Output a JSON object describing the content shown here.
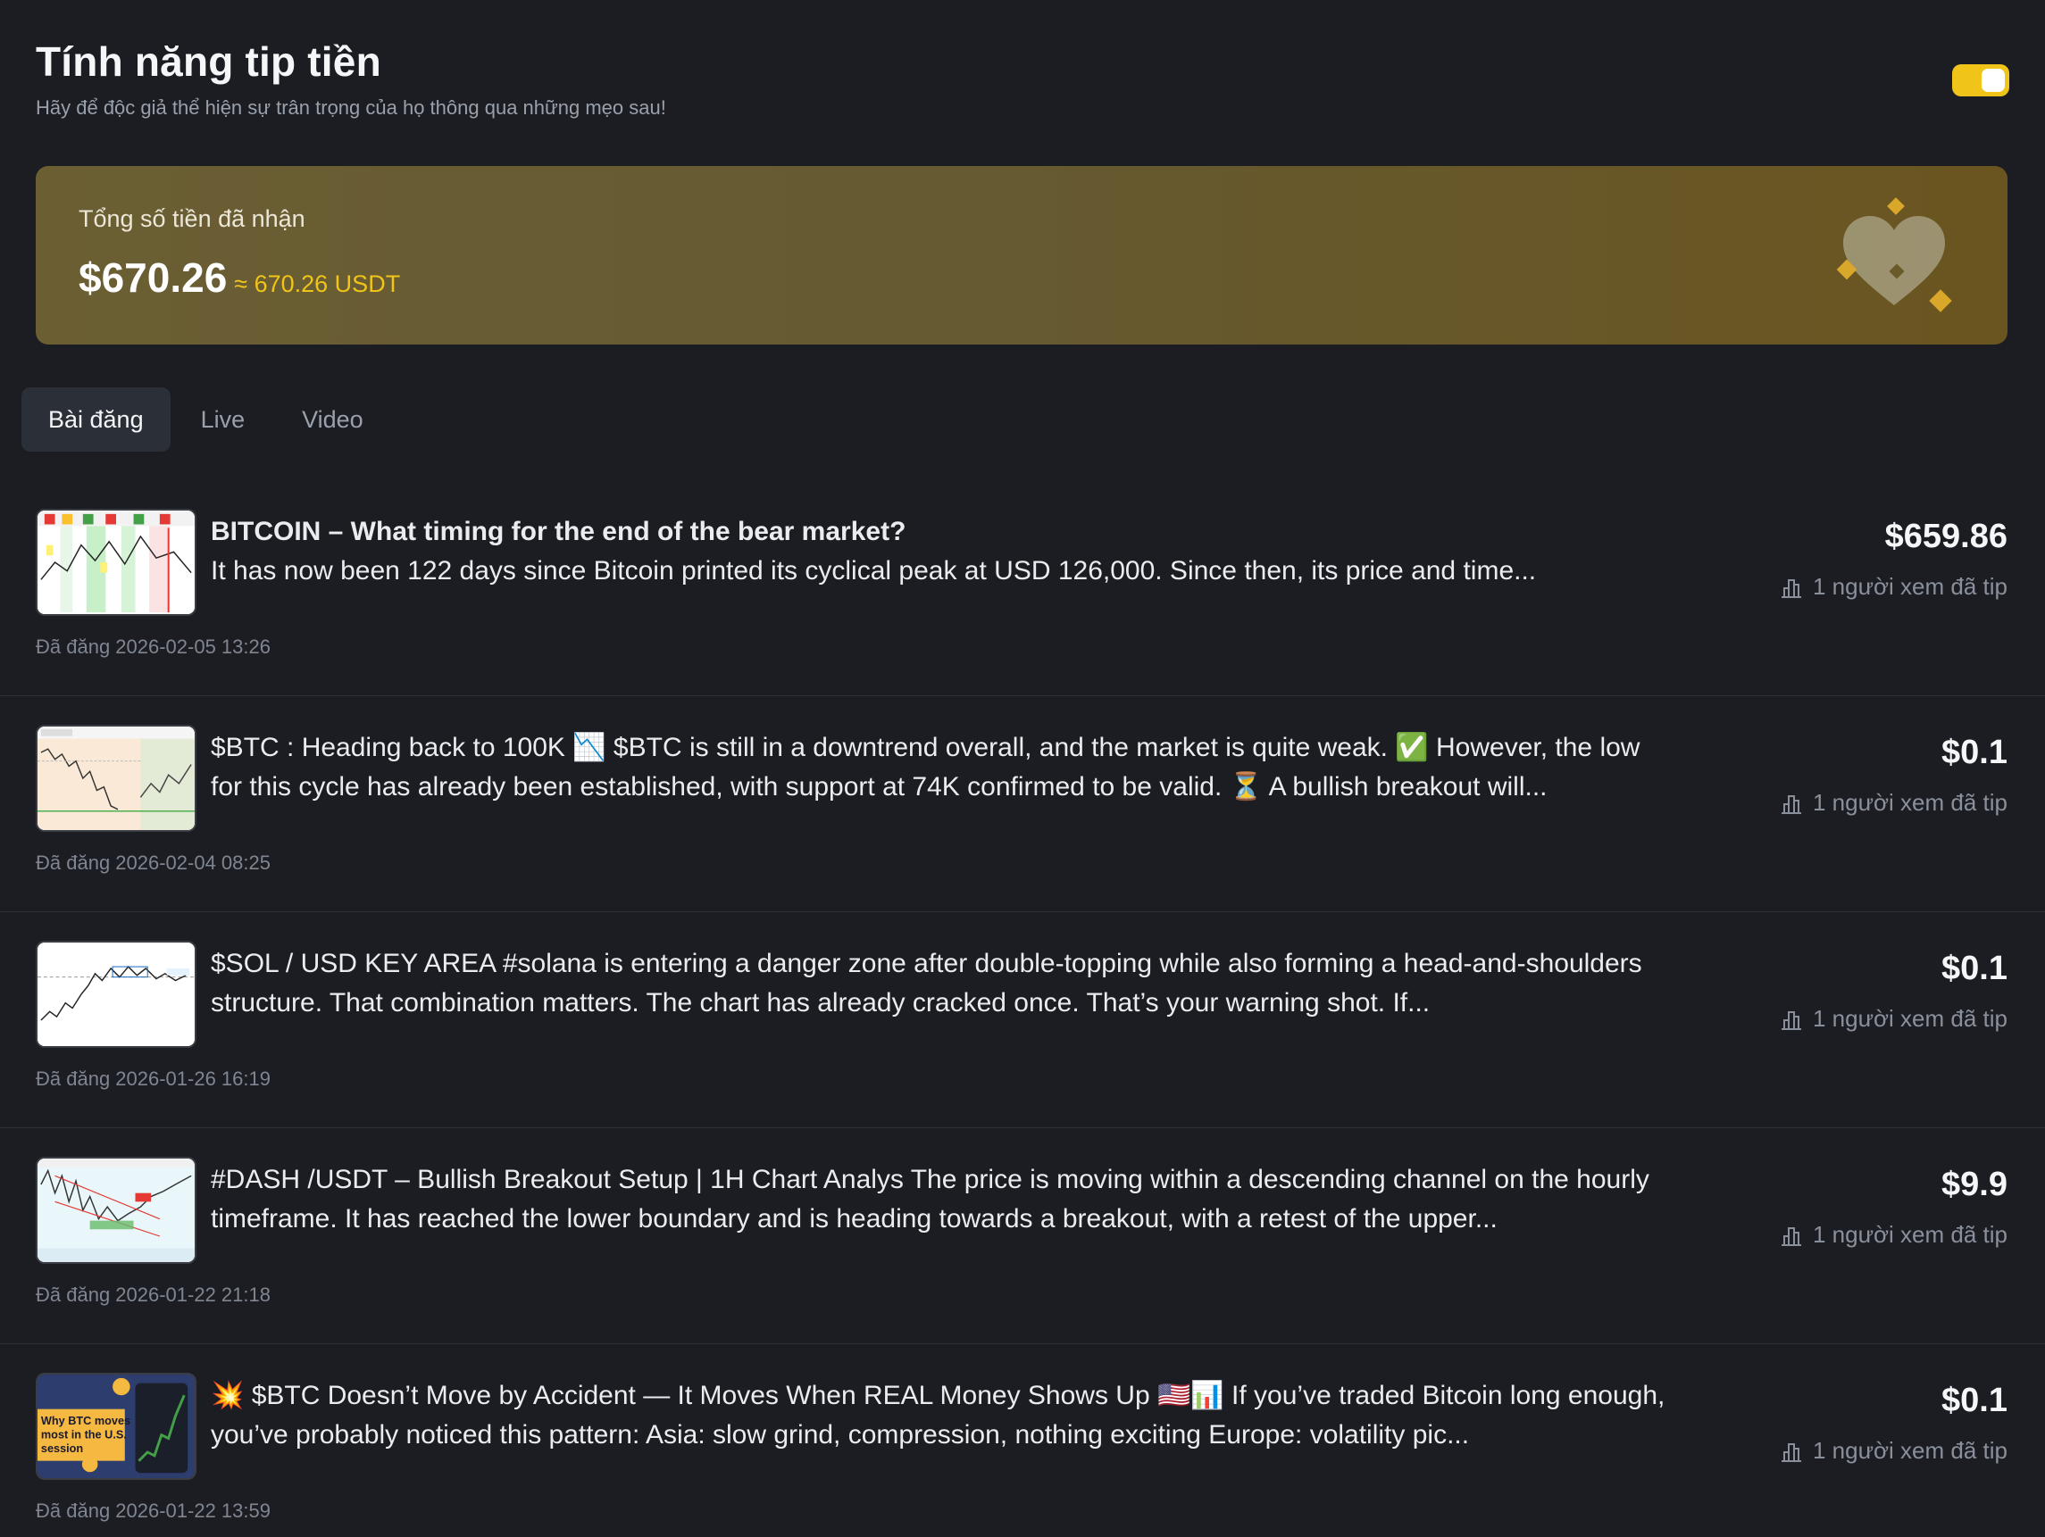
{
  "header": {
    "title": "Tính năng tip tiền",
    "subtitle": "Hãy để độc giả thể hiện sự trân trọng của họ thông qua những mẹo sau!",
    "toggle_on": true
  },
  "banner": {
    "label": "Tổng số tiền đã nhận",
    "amount": "$670.26",
    "approx": "≈ 670.26 USDT"
  },
  "tabs": [
    {
      "label": "Bài đăng",
      "active": true
    },
    {
      "label": "Live",
      "active": false
    },
    {
      "label": "Video",
      "active": false
    }
  ],
  "posts": [
    {
      "title": "BITCOIN – What timing for the end of the bear market?",
      "body": "It has now been 122 days since Bitcoin printed its cyclical peak at USD 126,000. Since then, its price and time...",
      "date": "Đã đăng 2026-02-05 13:26",
      "amount": "$659.86",
      "tips": "1 người xem đã tip"
    },
    {
      "title": "",
      "body": "$BTC : Heading back to 100K 📉 $BTC is still in a downtrend overall, and the market is quite weak. ✅ However, the low for this cycle has already been established, with support at 74K confirmed to be valid. ⏳ A bullish breakout will...",
      "date": "Đã đăng 2026-02-04 08:25",
      "amount": "$0.1",
      "tips": "1 người xem đã tip"
    },
    {
      "title": "",
      "body": "$SOL / USD KEY AREA #solana is entering a danger zone after double-topping while also forming a head-and-shoulders structure. That combination matters. The chart has already cracked once. That’s your warning shot. If...",
      "date": "Đã đăng 2026-01-26 16:19",
      "amount": "$0.1",
      "tips": "1 người xem đã tip"
    },
    {
      "title": "",
      "body": "#DASH /USDT – Bullish Breakout Setup | 1H Chart Analys The price is moving within a descending channel on the hourly timeframe. It has reached the lower boundary and is heading towards a breakout, with a retest of the upper...",
      "date": "Đã đăng 2026-01-22 21:18",
      "amount": "$9.9",
      "tips": "1 người xem đã tip"
    },
    {
      "title": "",
      "body": "💥 $BTC Doesn’t Move by Accident — It Moves When REAL Money Shows Up 🇺🇸📊 If you’ve traded Bitcoin long enough, you’ve probably noticed this pattern: Asia: slow grind, compression, nothing exciting Europe: volatility pic...",
      "date": "Đã đăng 2026-01-22 13:59",
      "amount": "$0.1",
      "tips": "1 người xem đã tip",
      "thumb_text": "Why BTC moves most in the U.S. session"
    }
  ],
  "icons": {
    "heart": "heart-sparkle-icon",
    "tip_stat": "bar-chart-icon"
  },
  "colors": {
    "accent": "#f0c419",
    "background": "#1c1d23",
    "banner": "#665a30"
  }
}
